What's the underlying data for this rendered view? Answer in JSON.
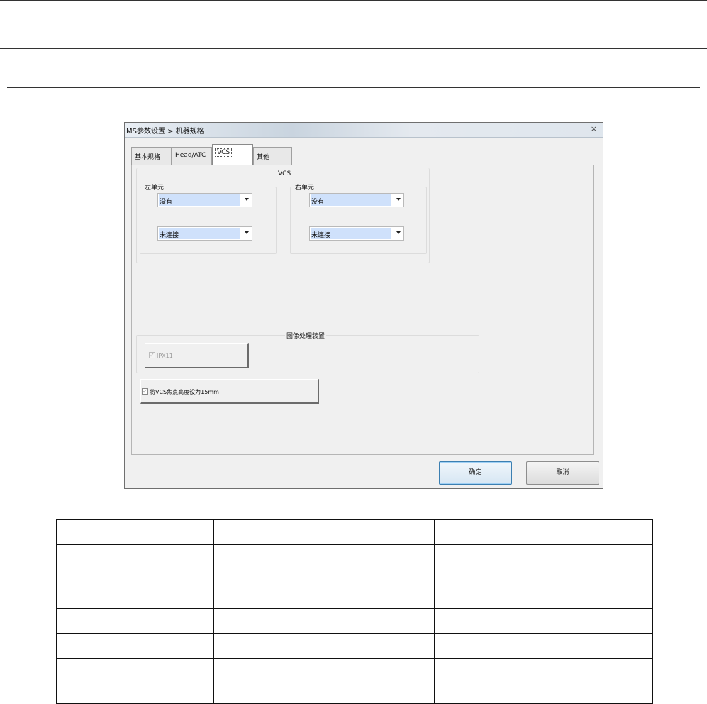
{
  "window": {
    "title": "MS参数设置 > 机器规格",
    "close_glyph": "×"
  },
  "tabs": [
    {
      "label": "基本规格"
    },
    {
      "label": "Head/ATC"
    },
    {
      "label": "VCS",
      "active": true
    },
    {
      "label": "其他"
    }
  ],
  "vcs": {
    "group_label": "VCS",
    "left_unit": {
      "label": "左单元",
      "type_value": "没有",
      "connection_value": "未连接"
    },
    "right_unit": {
      "label": "右单元",
      "type_value": "没有",
      "connection_value": "未连接"
    }
  },
  "image_processor": {
    "group_label": "图像处理装置",
    "ipx_label": "IPX11",
    "ipx_checked": true,
    "ipx_disabled": true
  },
  "focus_option": {
    "label": "将VCS焦点高度设为15mm",
    "checked": true
  },
  "buttons": {
    "ok_label": "确定",
    "cancel_label": "取消"
  },
  "icons": {
    "dropdown": "chevron-down-icon",
    "check": "checkmark-icon",
    "close": "close-icon"
  },
  "table": {
    "rows": [
      [
        "",
        "",
        ""
      ],
      [
        "",
        "",
        ""
      ],
      [
        "",
        "",
        ""
      ],
      [
        "",
        "",
        ""
      ],
      [
        "",
        "",
        ""
      ]
    ]
  }
}
